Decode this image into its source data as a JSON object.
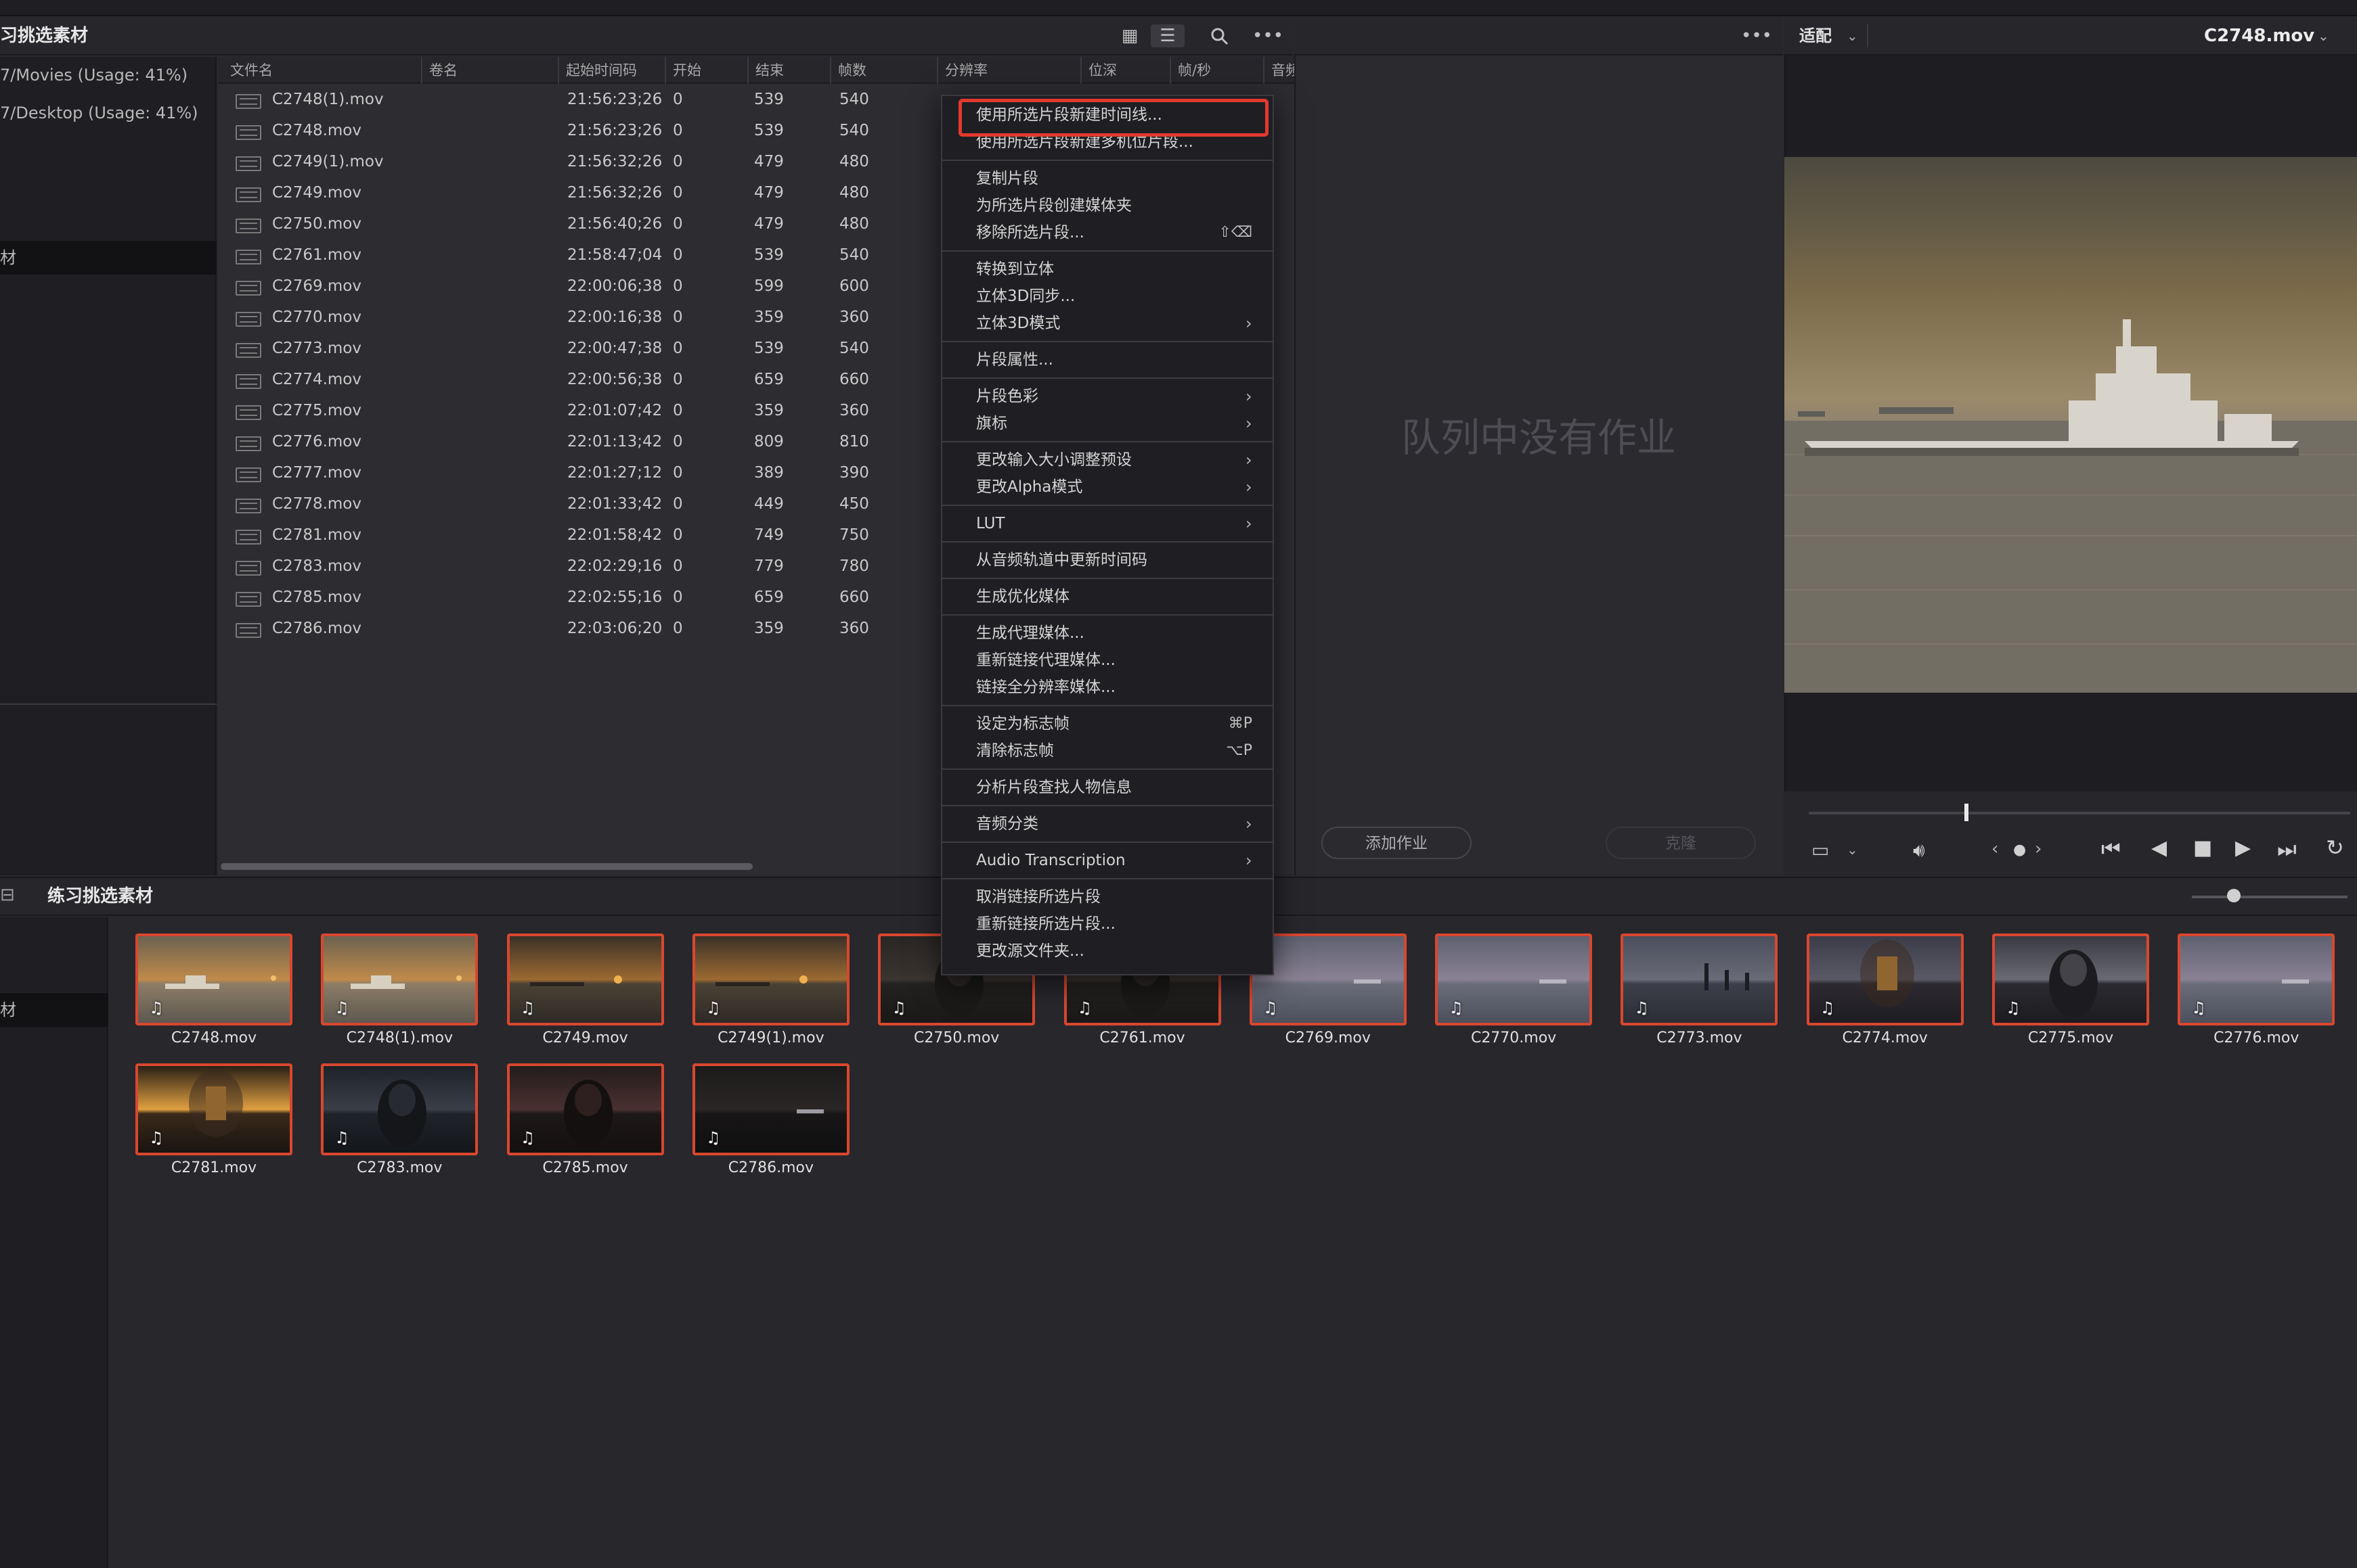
{
  "media_pool": {
    "title": "习挑选素材",
    "sidebar": [
      "7/Movies (Usage: 41%)",
      "7/Desktop (Usage: 41%)",
      "材"
    ],
    "columns": [
      "文件名",
      "卷名",
      "起始时间码",
      "开始",
      "结束",
      "帧数",
      "分辨率",
      "位深",
      "帧/秒",
      "音频"
    ],
    "rows": [
      {
        "name": "C2748(1).mov",
        "tc": "21:56:23;26",
        "start": "0",
        "end": "539",
        "frames": "540"
      },
      {
        "name": "C2748.mov",
        "tc": "21:56:23;26",
        "start": "0",
        "end": "539",
        "frames": "540"
      },
      {
        "name": "C2749(1).mov",
        "tc": "21:56:32;26",
        "start": "0",
        "end": "479",
        "frames": "480"
      },
      {
        "name": "C2749.mov",
        "tc": "21:56:32;26",
        "start": "0",
        "end": "479",
        "frames": "480"
      },
      {
        "name": "C2750.mov",
        "tc": "21:56:40;26",
        "start": "0",
        "end": "479",
        "frames": "480"
      },
      {
        "name": "C2761.mov",
        "tc": "21:58:47;04",
        "start": "0",
        "end": "539",
        "frames": "540"
      },
      {
        "name": "C2769.mov",
        "tc": "22:00:06;38",
        "start": "0",
        "end": "599",
        "frames": "600"
      },
      {
        "name": "C2770.mov",
        "tc": "22:00:16;38",
        "start": "0",
        "end": "359",
        "frames": "360"
      },
      {
        "name": "C2773.mov",
        "tc": "22:00:47;38",
        "start": "0",
        "end": "539",
        "frames": "540"
      },
      {
        "name": "C2774.mov",
        "tc": "22:00:56;38",
        "start": "0",
        "end": "659",
        "frames": "660"
      },
      {
        "name": "C2775.mov",
        "tc": "22:01:07;42",
        "start": "0",
        "end": "359",
        "frames": "360"
      },
      {
        "name": "C2776.mov",
        "tc": "22:01:13;42",
        "start": "0",
        "end": "809",
        "frames": "810"
      },
      {
        "name": "C2777.mov",
        "tc": "22:01:27;12",
        "start": "0",
        "end": "389",
        "frames": "390"
      },
      {
        "name": "C2778.mov",
        "tc": "22:01:33;42",
        "start": "0",
        "end": "449",
        "frames": "450"
      },
      {
        "name": "C2781.mov",
        "tc": "22:01:58;42",
        "start": "0",
        "end": "749",
        "frames": "750"
      },
      {
        "name": "C2783.mov",
        "tc": "22:02:29;16",
        "start": "0",
        "end": "779",
        "frames": "780"
      },
      {
        "name": "C2785.mov",
        "tc": "22:02:55;16",
        "start": "0",
        "end": "659",
        "frames": "660"
      },
      {
        "name": "C2786.mov",
        "tc": "22:03:06;20",
        "start": "0",
        "end": "359",
        "frames": "360"
      }
    ]
  },
  "context_menu": {
    "items": [
      {
        "label": "使用所选片段新建时间线...",
        "highlighted": true
      },
      {
        "label": "使用所选片段新建多机位片段..."
      },
      {
        "sep": true
      },
      {
        "label": "复制片段"
      },
      {
        "label": "为所选片段创建媒体夹"
      },
      {
        "label": "移除所选片段...",
        "shortcut": "⇧⌫"
      },
      {
        "sep": true
      },
      {
        "label": "转换到立体"
      },
      {
        "label": "立体3D同步..."
      },
      {
        "label": "立体3D模式",
        "submenu": true
      },
      {
        "sep": true
      },
      {
        "label": "片段属性..."
      },
      {
        "sep": true
      },
      {
        "label": "片段色彩",
        "submenu": true
      },
      {
        "label": "旗标",
        "submenu": true
      },
      {
        "sep": true
      },
      {
        "label": "更改输入大小调整预设",
        "submenu": true
      },
      {
        "label": "更改Alpha模式",
        "submenu": true
      },
      {
        "sep": true
      },
      {
        "label": "LUT",
        "submenu": true
      },
      {
        "sep": true
      },
      {
        "label": "从音频轨道中更新时间码"
      },
      {
        "sep": true
      },
      {
        "label": "生成优化媒体"
      },
      {
        "sep": true
      },
      {
        "label": "生成代理媒体..."
      },
      {
        "label": "重新链接代理媒体..."
      },
      {
        "label": "链接全分辨率媒体..."
      },
      {
        "sep": true
      },
      {
        "label": "设定为标志帧",
        "shortcut": "⌘P"
      },
      {
        "label": "清除标志帧",
        "shortcut": "⌥P"
      },
      {
        "sep": true
      },
      {
        "label": "分析片段查找人物信息"
      },
      {
        "sep": true
      },
      {
        "label": "音频分类",
        "submenu": true
      },
      {
        "sep": true
      },
      {
        "label": "Audio Transcription",
        "submenu": true
      },
      {
        "sep": true
      },
      {
        "label": "取消链接所选片段"
      },
      {
        "label": "重新链接所选片段..."
      },
      {
        "label": "更改源文件夹..."
      }
    ]
  },
  "render_queue": {
    "empty_text": "队列中没有作业",
    "add_job": "添加作业",
    "clone": "克隆"
  },
  "viewer": {
    "fit_label": "适配",
    "clip_name": "C2748.mov"
  },
  "bin": {
    "title": "练习挑选素材",
    "sidebar_label": "材",
    "thumbs": [
      {
        "name": "C2748.mov",
        "style": "sunset-ship"
      },
      {
        "name": "C2748(1).mov",
        "style": "sunset-ship"
      },
      {
        "name": "C2749.mov",
        "style": "sunset-dark"
      },
      {
        "name": "C2749(1).mov",
        "style": "sunset-dark"
      },
      {
        "name": "C2750.mov",
        "style": "dark-figure"
      },
      {
        "name": "C2761.mov",
        "style": "dark-figure"
      },
      {
        "name": "C2769.mov",
        "style": "dusk-sea"
      },
      {
        "name": "C2770.mov",
        "style": "dusk-sea"
      },
      {
        "name": "C2773.mov",
        "style": "dusk-pier"
      },
      {
        "name": "C2774.mov",
        "style": "lantern-girl"
      },
      {
        "name": "C2775.mov",
        "style": "portrait"
      },
      {
        "name": "C2776.mov",
        "style": "dusk-sea"
      },
      {
        "name": "C2781.mov",
        "style": "lantern-close"
      },
      {
        "name": "C2783.mov",
        "style": "night-figure"
      },
      {
        "name": "C2785.mov",
        "style": "night-portrait"
      },
      {
        "name": "C2786.mov",
        "style": "night-dark"
      }
    ]
  },
  "colors": {
    "accent_red": "#e3392f",
    "thumb_border": "#d9472f",
    "panel_bg": "#28282e"
  }
}
